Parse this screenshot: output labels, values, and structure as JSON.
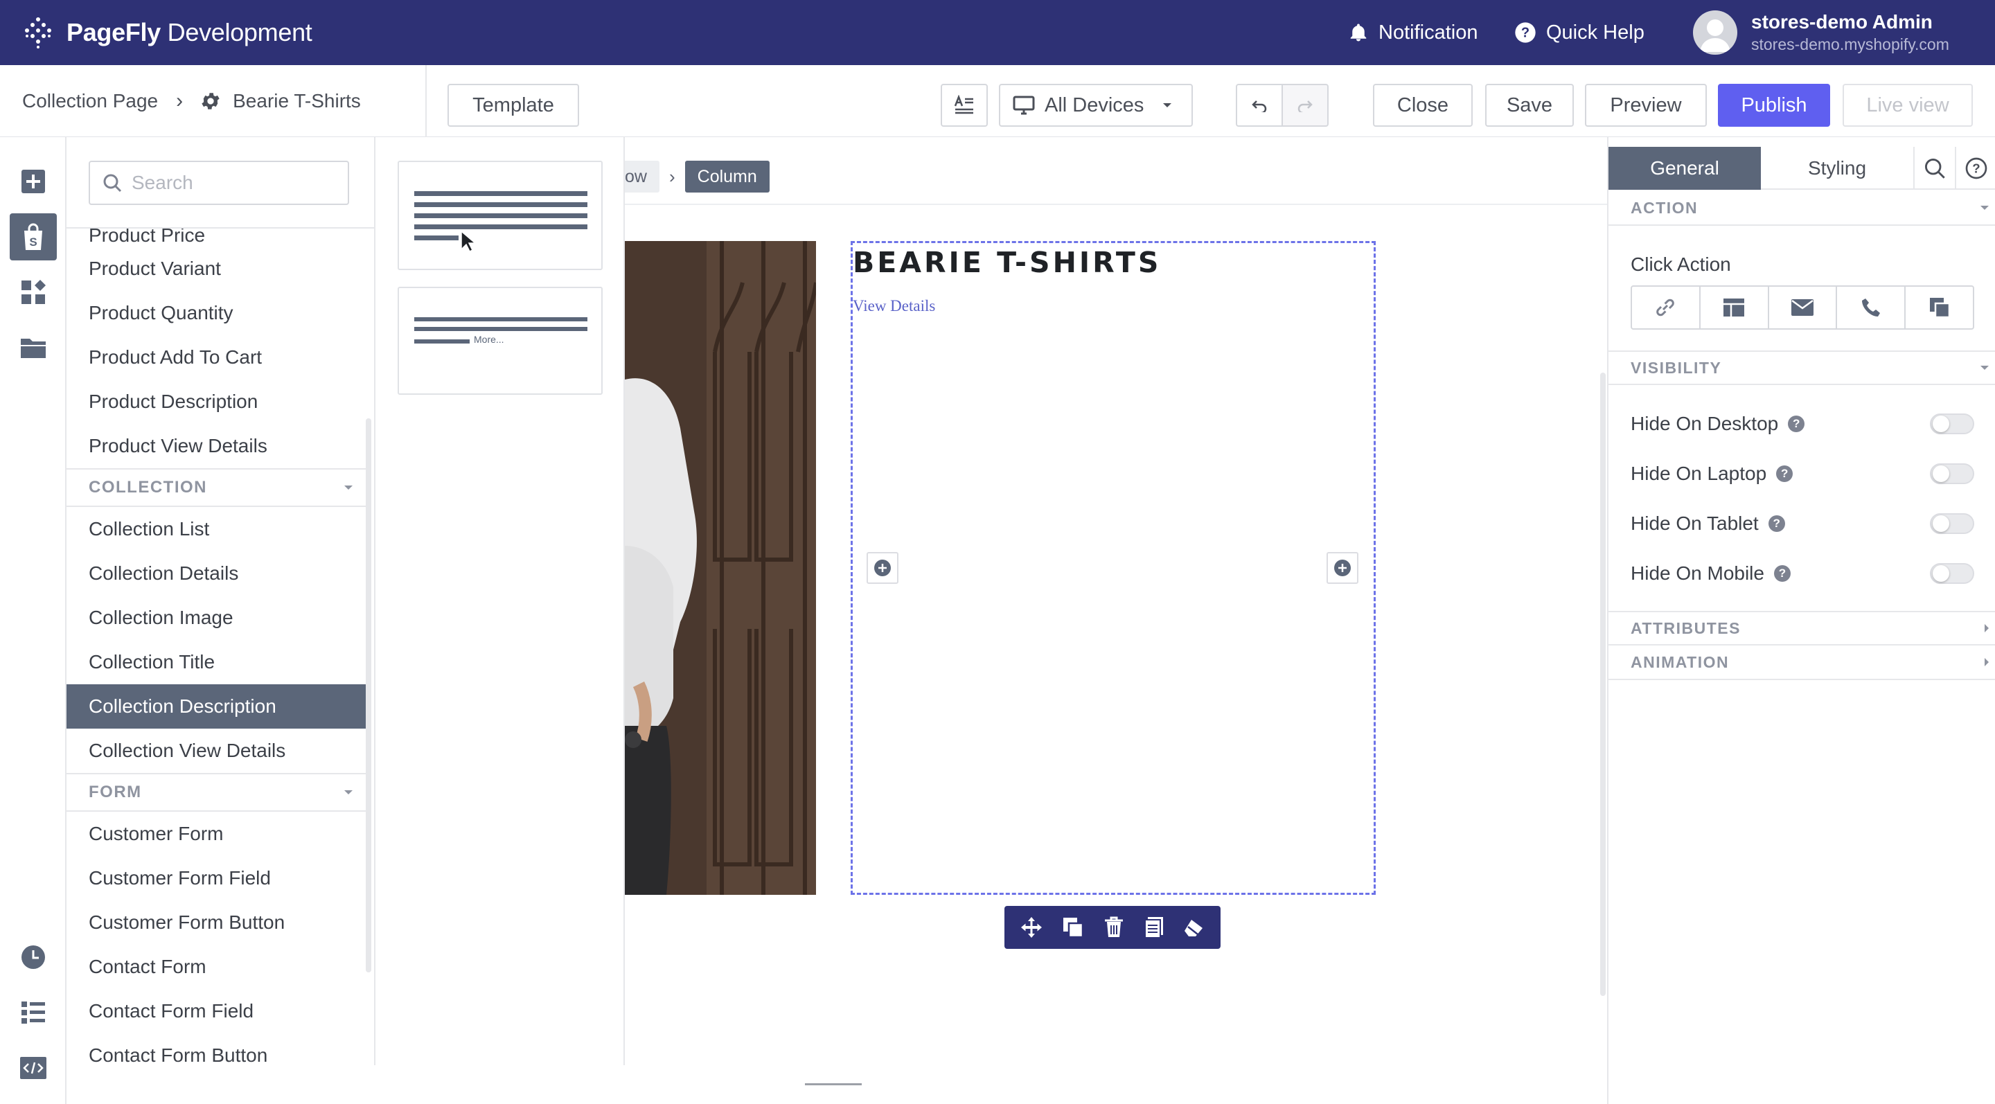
{
  "topbar": {
    "brand_bold": "PageFly",
    "brand_light": " Development",
    "notification": "Notification",
    "quick_help": "Quick Help",
    "user_name": "stores-demo Admin",
    "user_store": "stores-demo.myshopify.com"
  },
  "toolbar": {
    "crumb_root": "Collection Page",
    "crumb_sep": "›",
    "crumb_page": "Bearie T-Shirts",
    "template": "Template",
    "devices": "All Devices",
    "close": "Close",
    "save": "Save",
    "preview": "Preview",
    "publish": "Publish",
    "live_view": "Live view"
  },
  "element_panel": {
    "search_placeholder": "Search",
    "partial_item": "Product Price",
    "product_items": [
      "Product Variant",
      "Product Quantity",
      "Product Add To Cart",
      "Product Description",
      "Product View Details"
    ],
    "collection_heading": "COLLECTION",
    "collection_items": [
      "Collection List",
      "Collection Details",
      "Collection Image",
      "Collection Title",
      "Collection Description",
      "Collection View Details"
    ],
    "selected_item": "Collection Description",
    "form_heading": "FORM",
    "form_items": [
      "Customer Form",
      "Customer Form Field",
      "Customer Form Button",
      "Contact Form",
      "Contact Form Field",
      "Contact Form Button"
    ]
  },
  "variants": {
    "more_label": "More..."
  },
  "canvas": {
    "bc_row": "ow",
    "bc_arrow": "›",
    "bc_column": "Column",
    "title": "BEARIE T-SHIRTS",
    "link": "View Details"
  },
  "right_panel": {
    "tab_general": "General",
    "tab_styling": "Styling",
    "section_action": "ACTION",
    "click_action": "Click Action",
    "section_visibility": "VISIBILITY",
    "hide_desktop": "Hide On Desktop",
    "hide_laptop": "Hide On Laptop",
    "hide_tablet": "Hide On Tablet",
    "hide_mobile": "Hide On Mobile",
    "section_attributes": "ATTRIBUTES",
    "section_animation": "ANIMATION"
  },
  "colors": {
    "topbar": "#2e3175",
    "accent": "#5f5ff0",
    "selected": "#5b6679",
    "column_border": "#6d73e8"
  },
  "icons": [
    "bell-icon",
    "help-icon",
    "gear-icon",
    "text-icon",
    "desktop-icon",
    "undo-icon",
    "redo-icon",
    "search-icon",
    "plus-icon",
    "shopify-icon",
    "widgets-icon",
    "folder-icon",
    "clock-icon",
    "list-icon",
    "code-icon",
    "link-icon",
    "layout-icon",
    "mail-icon",
    "phone-icon",
    "copy-icon",
    "move-icon",
    "trash-icon",
    "duplicate-icon",
    "eraser-icon"
  ]
}
